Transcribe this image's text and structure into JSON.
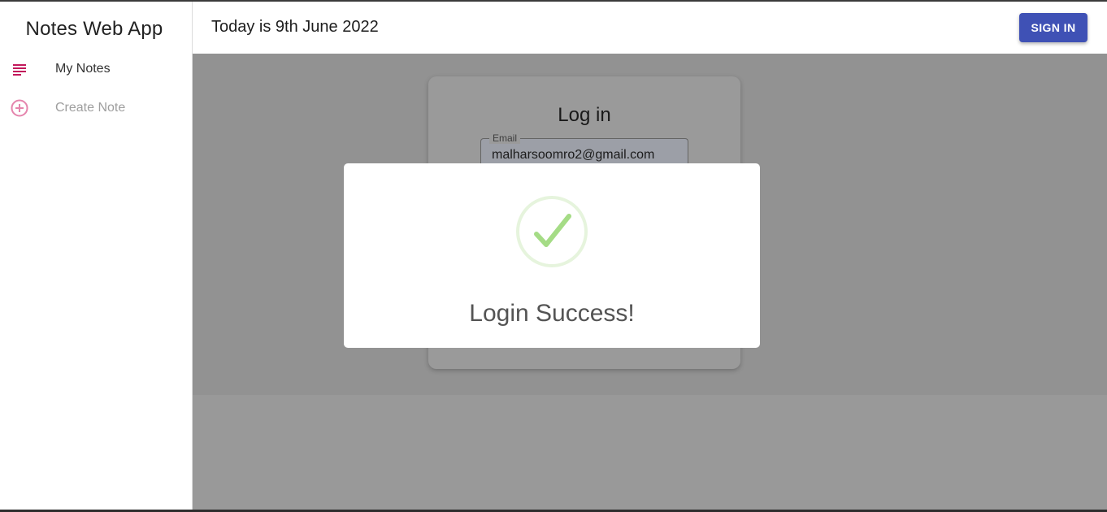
{
  "app": {
    "title": "Notes Web App"
  },
  "sidebar": {
    "items": [
      {
        "label": "My Notes",
        "icon": "notes-list-icon"
      },
      {
        "label": "Create Note",
        "icon": "add-circle-icon"
      }
    ]
  },
  "header": {
    "date_text": "Today is 9th June 2022",
    "signin_label": "SIGN IN"
  },
  "login": {
    "title": "Log in",
    "email_label": "Email",
    "email_value": "malharsoomro2@gmail.com"
  },
  "modal": {
    "icon": "success-check-icon",
    "title": "Login Success!"
  },
  "colors": {
    "accent": "#3f51b5",
    "sidebar_icon": "#c2185b",
    "success": "#a5dc86"
  }
}
